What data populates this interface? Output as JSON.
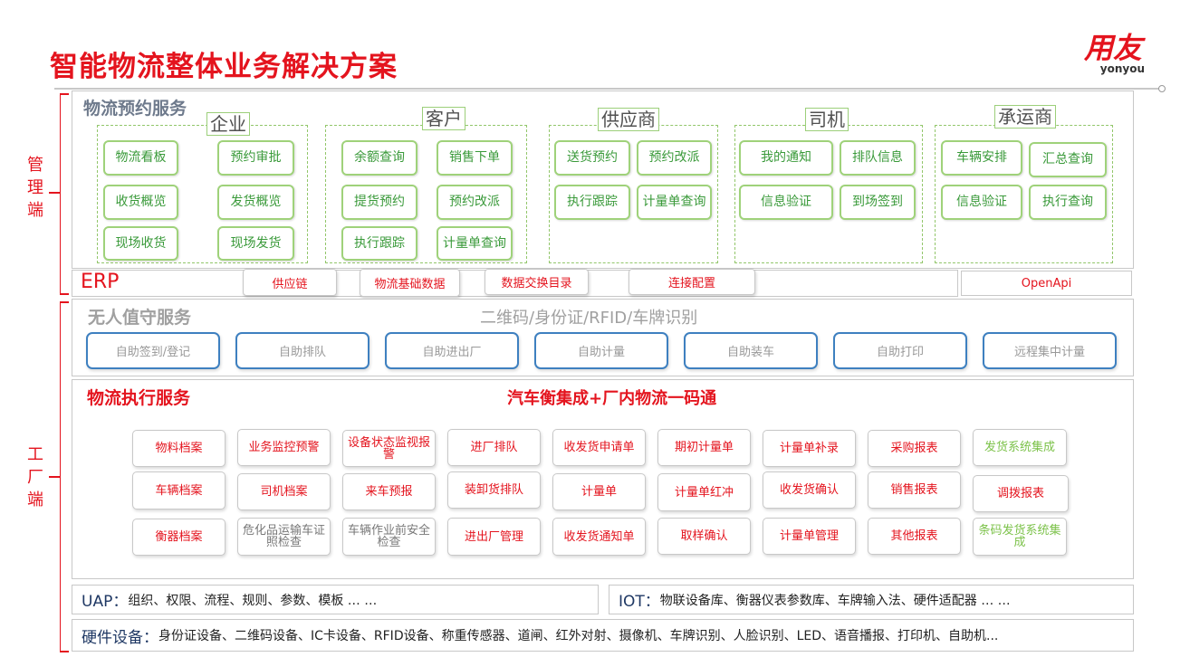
{
  "title": "智能物流整体业务解决方案",
  "brand": {
    "cn": "用友",
    "en": "yonyou"
  },
  "side_labels": {
    "management": "管理端",
    "factory": "工厂端"
  },
  "booking": {
    "title": "物流预约服务",
    "groups": [
      {
        "name": "企业",
        "items": [
          "物流看板",
          "预约审批",
          "收货概览",
          "发货概览",
          "现场收货",
          "现场发货"
        ]
      },
      {
        "name": "客户",
        "items": [
          "余额查询",
          "销售下单",
          "提货预约",
          "预约改派",
          "执行跟踪",
          "计量单查询"
        ]
      },
      {
        "name": "供应商",
        "items": [
          "送货预约",
          "预约改派",
          "执行跟踪",
          "计量单查询"
        ]
      },
      {
        "name": "司机",
        "items": [
          "我的通知",
          "排队信息",
          "信息验证",
          "到场签到"
        ]
      },
      {
        "name": "承运商",
        "items": [
          "车辆安排",
          "汇总查询",
          "信息验证",
          "执行查询"
        ]
      }
    ]
  },
  "erp": {
    "label": "ERP",
    "items": [
      "供应链",
      "物流基础数据",
      "数据交换目录",
      "连接配置"
    ],
    "openapi": "OpenApi"
  },
  "unmanned": {
    "title": "无人值守服务",
    "subtitle": "二维码/身份证/RFID/车牌识别",
    "items": [
      "自助签到/登记",
      "自助排队",
      "自助进出厂",
      "自助计量",
      "自助装车",
      "自助打印",
      "远程集中计量"
    ]
  },
  "execution": {
    "title": "物流执行服务",
    "subtitle": "汽车衡集成+厂内物流一码通",
    "rows": [
      [
        "物料档案",
        "业务监控预警",
        "设备状态监视报警",
        "进厂排队",
        "收发货申请单",
        "期初计量单",
        "计量单补录",
        "采购报表",
        "发货系统集成"
      ],
      [
        "车辆档案",
        "司机档案",
        "来车预报",
        "装卸货排队",
        "计量单",
        "计量单红冲",
        "收发货确认",
        "销售报表",
        "调拨报表"
      ],
      [
        "衡器档案",
        "危化品运输车证照检查",
        "车辆作业前安全检查",
        "进出厂管理",
        "收发货通知单",
        "取样确认",
        "计量单管理",
        "其他报表",
        "条码发货系统集成"
      ]
    ]
  },
  "uap": {
    "label": "UAP：",
    "text": "组织、权限、流程、规则、参数、模板 … …"
  },
  "iot": {
    "label": "IOT：",
    "text": "物联设备库、衡器仪表参数库、车牌输入法、硬件适配器 … …"
  },
  "hardware": {
    "label": "硬件设备：",
    "text": "身份证设备、二维码设备、IC卡设备、RFID设备、称重传感器、道闸、红外对射、摄像机、车牌识别、人脸识别、LED、语音播报、打印机、自助机..."
  },
  "colors": {
    "accent_red": "#e4141e",
    "green_border": "#9fd27a",
    "green_text": "#3a9a3a",
    "blue_border": "#3e80c0"
  }
}
